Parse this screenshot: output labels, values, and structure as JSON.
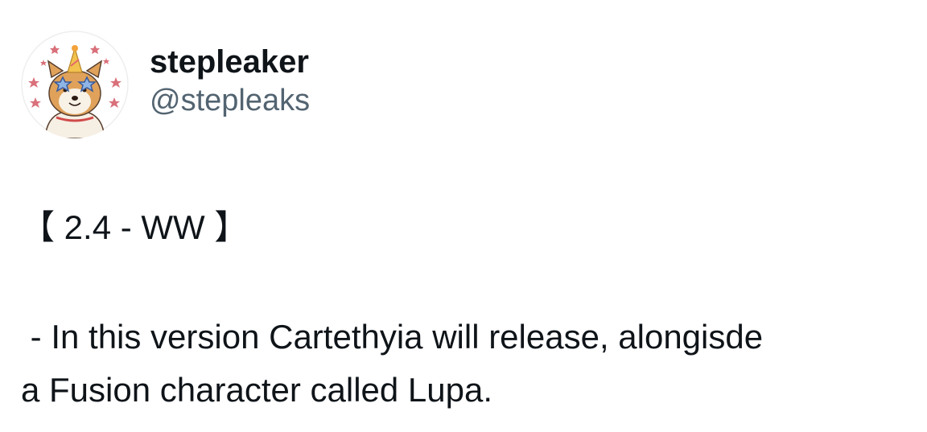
{
  "post": {
    "author": {
      "display_name": "stepleaker",
      "handle": "@stepleaks",
      "avatar_icon": "shiba-inu-party-avatar-icon"
    },
    "text": {
      "header_line": "【 2.4 - WW 】",
      "line_1": " - In this version Cartethyia will release, alongisde",
      "line_2": "a Fusion character called Lupa."
    }
  },
  "colors": {
    "text_primary": "#0f1419",
    "text_secondary": "#536471",
    "background": "#ffffff"
  }
}
